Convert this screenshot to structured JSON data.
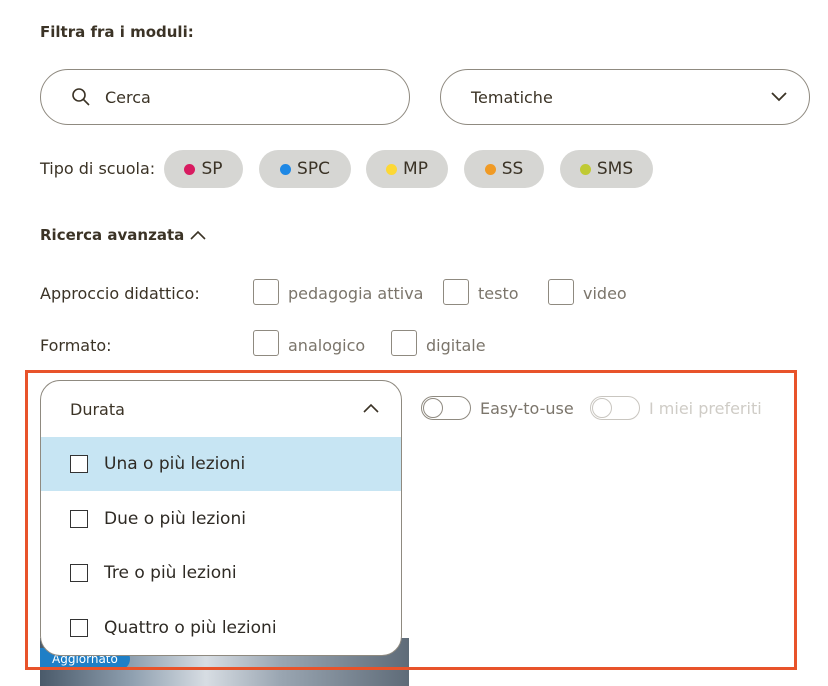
{
  "filter": {
    "heading": "Filtra fra i moduli:",
    "search": {
      "placeholder": "Cerca",
      "icon": "search-icon"
    },
    "themes": {
      "value": "Tematiche",
      "icon": "chevron-down-icon"
    }
  },
  "school_type": {
    "label": "Tipo di scuola:",
    "chips": [
      {
        "label": "SP",
        "color": "#d81b60"
      },
      {
        "label": "SPC",
        "color": "#1e88e5"
      },
      {
        "label": "MP",
        "color": "#fdd835"
      },
      {
        "label": "SS",
        "color": "#f09a24"
      },
      {
        "label": "SMS",
        "color": "#c0ca33"
      }
    ]
  },
  "advanced": {
    "label": "Ricerca avanzata",
    "icon": "chevron-up-icon",
    "approach": {
      "label": "Approccio didattico:",
      "options": [
        "pedagogia attiva",
        "testo",
        "video"
      ]
    },
    "format": {
      "label": "Formato:",
      "options": [
        "analogico",
        "digitale"
      ]
    },
    "duration": {
      "label": "Durata",
      "icon": "chevron-up-icon",
      "options": [
        "Una o più lezioni",
        "Due o più lezioni",
        "Tre o più lezioni",
        "Quattro o più lezioni"
      ],
      "highlighted_option": "Una o più lezioni"
    },
    "toggles": [
      "Easy-to-use",
      "I miei preferiti"
    ]
  },
  "card": {
    "badge": "Aggiornato"
  },
  "colors": {
    "highlight_border": "#e8532a",
    "option_highlight": "#c7e5f3",
    "badge": "#1f7fc6"
  }
}
